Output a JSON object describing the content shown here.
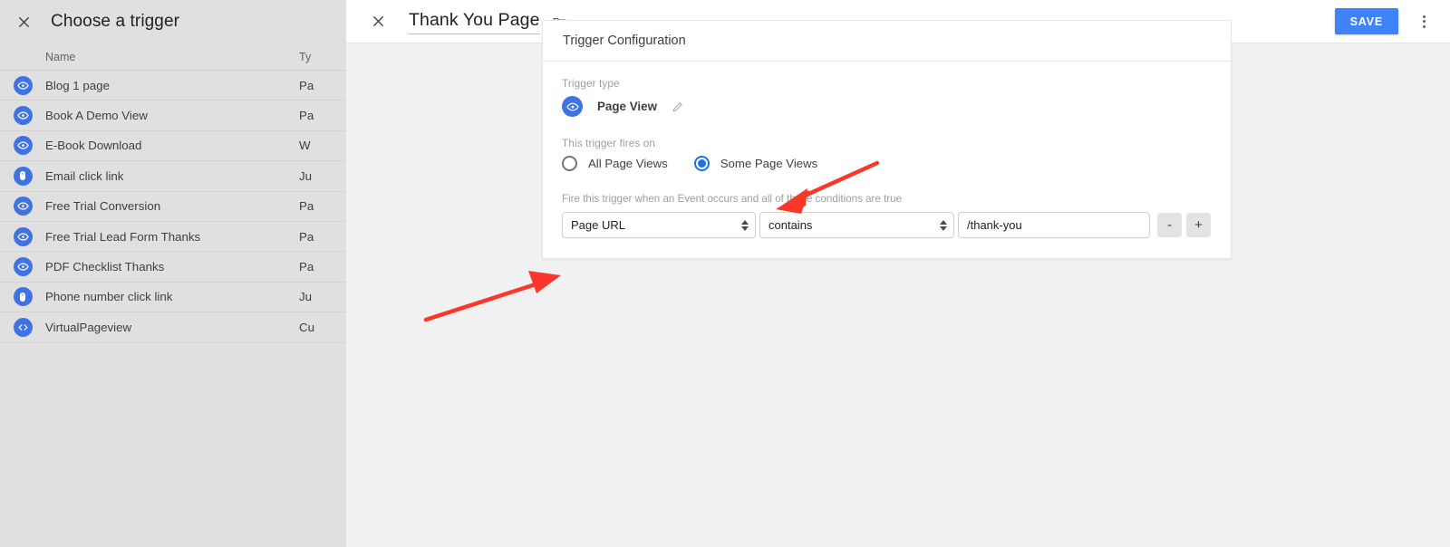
{
  "sidebar": {
    "title": "Choose a trigger",
    "close_icon": "close-icon",
    "columns": {
      "name": "Name",
      "type": "Ty"
    },
    "rows": [
      {
        "icon": "eye-icon",
        "name": "Blog 1 page",
        "type": "Pa"
      },
      {
        "icon": "eye-icon",
        "name": "Book A Demo View",
        "type": "Pa"
      },
      {
        "icon": "eye-icon",
        "name": "E-Book Download",
        "type": "W"
      },
      {
        "icon": "click-icon",
        "name": "Email click link",
        "type": "Ju"
      },
      {
        "icon": "eye-icon",
        "name": "Free Trial Conversion",
        "type": "Pa"
      },
      {
        "icon": "eye-icon",
        "name": "Free Trial Lead Form Thanks",
        "type": "Pa"
      },
      {
        "icon": "eye-icon",
        "name": "PDF Checklist Thanks",
        "type": "Pa"
      },
      {
        "icon": "click-icon",
        "name": "Phone number click link",
        "type": "Ju"
      },
      {
        "icon": "code-icon",
        "name": "VirtualPageview",
        "type": "Cu"
      }
    ]
  },
  "header": {
    "close_icon": "close-icon",
    "title": "Thank You Page",
    "folder_icon": "folder-icon",
    "save_label": "SAVE",
    "more_icon": "more-vert-icon"
  },
  "card": {
    "heading": "Trigger Configuration",
    "trigger_type": {
      "label": "Trigger type",
      "icon": "eye-icon",
      "value": "Page View",
      "edit_icon": "pencil-icon"
    },
    "fires_on": {
      "label": "This trigger fires on",
      "options": [
        {
          "label": "All Page Views",
          "selected": false
        },
        {
          "label": "Some Page Views",
          "selected": true
        }
      ]
    },
    "conditions": {
      "label": "Fire this trigger when an Event occurs and all of these conditions are true",
      "variable": "Page URL",
      "operator": "contains",
      "value": "/thank-you",
      "value_placeholder": "",
      "remove_label": "-",
      "add_label": "+"
    }
  },
  "colors": {
    "accent_blue": "#3f83f8",
    "icon_blue": "#3f73e3",
    "radio_blue": "#1a73e8",
    "annotation_red": "#f9372a",
    "sidebar_bg": "#e0e0e0",
    "main_bg": "#f1f1f1"
  }
}
